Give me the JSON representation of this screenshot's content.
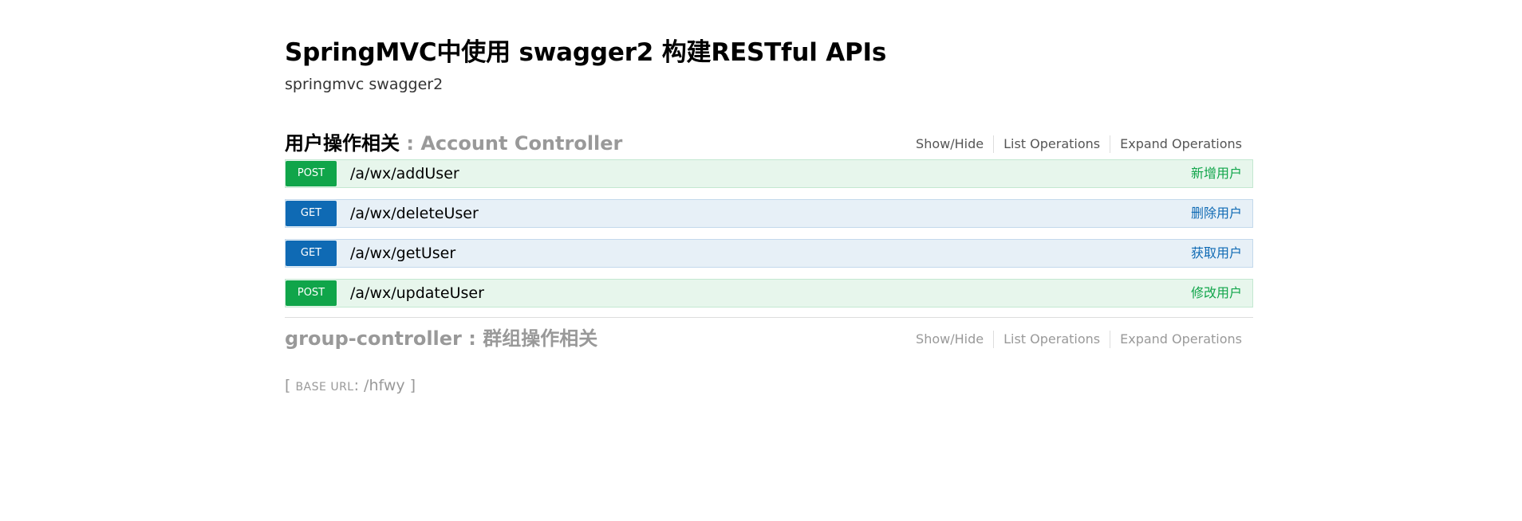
{
  "info": {
    "title": "SpringMVC中使用 swagger2 构建RESTful APIs",
    "description": "springmvc swagger2"
  },
  "resources": [
    {
      "name": "用户操作相关",
      "separator": " : ",
      "description": "Account Controller",
      "options": [
        "Show/Hide",
        "List Operations",
        "Expand Operations"
      ],
      "operations": [
        {
          "method": "POST",
          "path": "/a/wx/addUser",
          "summary": "新增用户"
        },
        {
          "method": "GET",
          "path": "/a/wx/deleteUser",
          "summary": "删除用户"
        },
        {
          "method": "GET",
          "path": "/a/wx/getUser",
          "summary": "获取用户"
        },
        {
          "method": "POST",
          "path": "/a/wx/updateUser",
          "summary": "修改用户"
        }
      ]
    },
    {
      "name": "group-controller",
      "separator": " : ",
      "description": "群组操作相关",
      "options": [
        "Show/Hide",
        "List Operations",
        "Expand Operations"
      ]
    }
  ],
  "base_url": {
    "open": "[ ",
    "label": "BASE URL",
    "colon": ": ",
    "value": "/hfwy",
    "close": " ]"
  },
  "colors": {
    "post": "#10a54a",
    "get": "#0f6ab4",
    "post_bg": "#e7f6ec",
    "get_bg": "#e7f0f7",
    "muted": "#999999"
  }
}
